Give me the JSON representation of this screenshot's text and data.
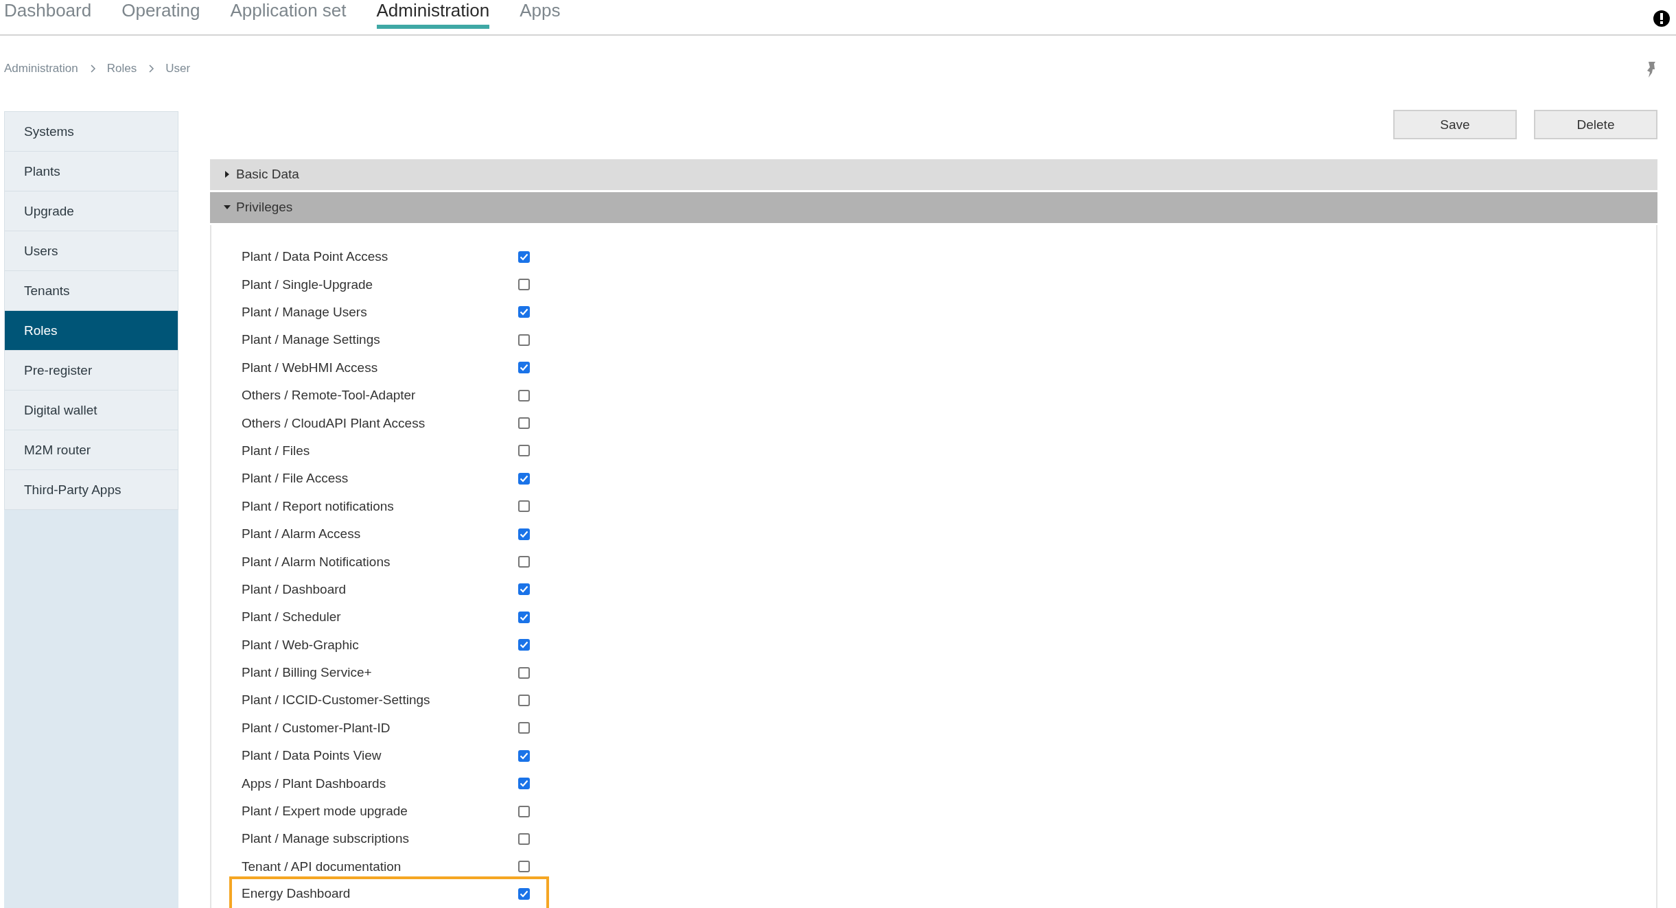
{
  "nav_tabs": [
    {
      "label": "Dashboard",
      "selected": false
    },
    {
      "label": "Operating",
      "selected": false
    },
    {
      "label": "Application set",
      "selected": false
    },
    {
      "label": "Administration",
      "selected": true
    },
    {
      "label": "Apps",
      "selected": false
    }
  ],
  "breadcrumb": [
    "Administration",
    "Roles",
    "User"
  ],
  "buttons": [
    "Save",
    "Delete"
  ],
  "sidebar": {
    "items": [
      {
        "label": "Systems",
        "selected": false
      },
      {
        "label": "Plants",
        "selected": false
      },
      {
        "label": "Upgrade",
        "selected": false
      },
      {
        "label": "Users",
        "selected": false
      },
      {
        "label": "Tenants",
        "selected": false
      },
      {
        "label": "Roles",
        "selected": true
      },
      {
        "label": "Pre-register",
        "selected": false
      },
      {
        "label": "Digital wallet",
        "selected": false
      },
      {
        "label": "M2M router",
        "selected": false
      },
      {
        "label": "Third-Party Apps",
        "selected": false
      }
    ]
  },
  "sections": [
    {
      "title": "Basic Data",
      "expanded": false
    },
    {
      "title": "Privileges",
      "expanded": true
    }
  ],
  "privileges": [
    {
      "label": "Plant / Data Point Access",
      "checked": true,
      "highlighted": false
    },
    {
      "label": "Plant / Single-Upgrade",
      "checked": false,
      "highlighted": false
    },
    {
      "label": "Plant / Manage Users",
      "checked": true,
      "highlighted": false
    },
    {
      "label": "Plant / Manage Settings",
      "checked": false,
      "highlighted": false
    },
    {
      "label": "Plant / WebHMI Access",
      "checked": true,
      "highlighted": false
    },
    {
      "label": "Others / Remote-Tool-Adapter",
      "checked": false,
      "highlighted": false
    },
    {
      "label": "Others / CloudAPI Plant Access",
      "checked": false,
      "highlighted": false
    },
    {
      "label": "Plant / Files",
      "checked": false,
      "highlighted": false
    },
    {
      "label": "Plant / File Access",
      "checked": true,
      "highlighted": false
    },
    {
      "label": "Plant / Report notifications",
      "checked": false,
      "highlighted": false
    },
    {
      "label": "Plant / Alarm Access",
      "checked": true,
      "highlighted": false
    },
    {
      "label": "Plant / Alarm Notifications",
      "checked": false,
      "highlighted": false
    },
    {
      "label": "Plant / Dashboard",
      "checked": true,
      "highlighted": false
    },
    {
      "label": "Plant / Scheduler",
      "checked": true,
      "highlighted": false
    },
    {
      "label": "Plant / Web-Graphic",
      "checked": true,
      "highlighted": false
    },
    {
      "label": "Plant / Billing Service+",
      "checked": false,
      "highlighted": false
    },
    {
      "label": "Plant / ICCID-Customer-Settings",
      "checked": false,
      "highlighted": false
    },
    {
      "label": "Plant / Customer-Plant-ID",
      "checked": false,
      "highlighted": false
    },
    {
      "label": "Plant / Data Points View",
      "checked": true,
      "highlighted": false
    },
    {
      "label": "Apps / Plant Dashboards",
      "checked": true,
      "highlighted": false
    },
    {
      "label": "Plant / Expert mode upgrade",
      "checked": false,
      "highlighted": false
    },
    {
      "label": "Plant / Manage subscriptions",
      "checked": false,
      "highlighted": false
    },
    {
      "label": "Tenant / API documentation",
      "checked": false,
      "highlighted": false
    },
    {
      "label": "Energy Dashboard",
      "checked": true,
      "highlighted": true
    }
  ]
}
